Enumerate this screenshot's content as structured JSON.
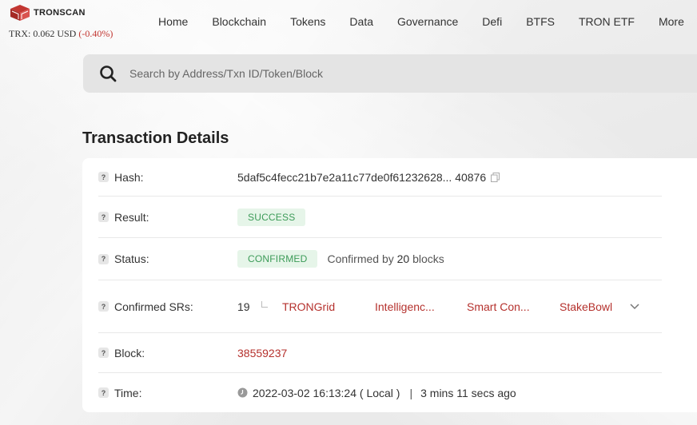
{
  "header": {
    "logo_text": "TRONSCAN",
    "price_label": "TRX: 0.062 USD",
    "price_change": "(-0.40%)",
    "nav": [
      "Home",
      "Blockchain",
      "Tokens",
      "Data",
      "Governance",
      "Defi",
      "BTFS",
      "TRON ETF",
      "More"
    ]
  },
  "search": {
    "placeholder": "Search by Address/Txn ID/Token/Block"
  },
  "page_title": "Transaction Details",
  "details": {
    "hash": {
      "label": "Hash:",
      "value": "5daf5c4fecc21b7e2a11c77de0f61232628... 40876"
    },
    "result": {
      "label": "Result:",
      "value": "SUCCESS"
    },
    "status": {
      "label": "Status:",
      "value": "CONFIRMED",
      "confirmed_prefix": "Confirmed by",
      "confirmed_count": "20",
      "confirmed_suffix": "blocks"
    },
    "srs": {
      "label": "Confirmed SRs:",
      "count": "19",
      "items": [
        "TRONGrid",
        "Intelligenc...",
        "Smart Con...",
        "StakeBowl"
      ]
    },
    "block": {
      "label": "Block:",
      "value": "38559237"
    },
    "time": {
      "label": "Time:",
      "value": "2022-03-02 16:13:24 ( Local )",
      "separator": "|",
      "ago": "3 mins 11 secs ago"
    }
  },
  "colors": {
    "link": "#b5312d",
    "success_text": "#3c9b58",
    "success_bg": "#e6f5e9",
    "price_down": "#c23631"
  }
}
